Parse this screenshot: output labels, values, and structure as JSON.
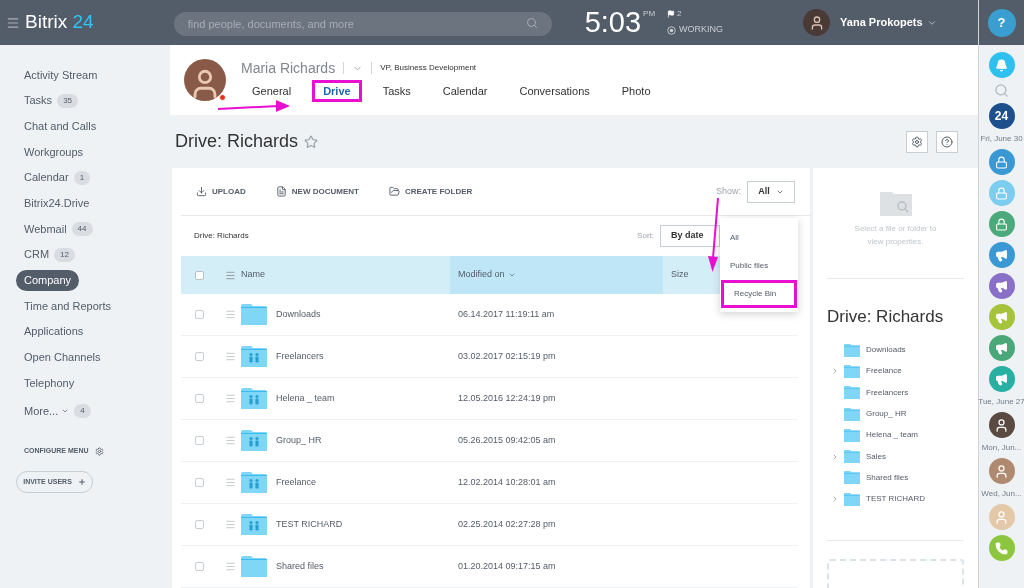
{
  "header": {
    "logo_word": "Bitrix",
    "logo_number": "24",
    "search": {
      "placeholder": "find people, documents, and more"
    },
    "time": "5:03",
    "ampm": "PM",
    "flags": "2",
    "status": "WORKING",
    "user": "Yana Prokopets"
  },
  "sidebar": {
    "items": [
      {
        "label": "Activity Stream",
        "selected": false
      },
      {
        "label": "Tasks",
        "badge": "35",
        "selected": false
      },
      {
        "label": "Chat and Calls",
        "selected": false
      },
      {
        "label": "Workgroups",
        "selected": false
      },
      {
        "label": "Calendar",
        "badge": "1",
        "selected": false
      },
      {
        "label": "Bitrix24.Drive",
        "selected": false
      },
      {
        "label": "Webmail",
        "badge": "44",
        "selected": false
      },
      {
        "label": "CRM",
        "badge": "12",
        "selected": false
      },
      {
        "label": "Company",
        "selected": true
      },
      {
        "label": "Time and Reports",
        "selected": false
      },
      {
        "label": "Applications",
        "selected": false
      },
      {
        "label": "Open Channels",
        "selected": false
      },
      {
        "label": "Telephony",
        "selected": false
      }
    ],
    "more": {
      "label": "More...",
      "badge": "4"
    },
    "configure": "CONFIGURE MENU",
    "invite": "INVITE USERS"
  },
  "profile": {
    "name": "Maria Richards",
    "position": "VP, Business Development",
    "online": false,
    "tabs": [
      {
        "label": "General",
        "selected": false,
        "highlighted": false
      },
      {
        "label": "Drive",
        "selected": true,
        "highlighted": true
      },
      {
        "label": "Tasks",
        "selected": false,
        "highlighted": false
      },
      {
        "label": "Calendar",
        "selected": false,
        "highlighted": false
      },
      {
        "label": "Conversations",
        "selected": false,
        "highlighted": false
      },
      {
        "label": "Photo",
        "selected": false,
        "highlighted": false
      }
    ]
  },
  "page_title": "Drive: Richards",
  "toolbar": {
    "actions": [
      {
        "kind": "upload",
        "label": "UPLOAD"
      },
      {
        "kind": "document",
        "label": "NEW DOCUMENT"
      },
      {
        "kind": "folder",
        "label": "CREATE FOLDER"
      }
    ],
    "show_label": "Show:",
    "show_value": "All",
    "menu": [
      {
        "label": "All",
        "highlighted": false
      },
      {
        "label": "Public files",
        "highlighted": false
      },
      {
        "label": "Recycle Bin",
        "highlighted": true
      }
    ]
  },
  "breadcrumb": "Drive: Richards",
  "sort_label": "Sort:",
  "sort_value": "By date",
  "table": {
    "all_checked": false,
    "columns": [
      {
        "label": "Name",
        "sorted": false
      },
      {
        "label": "Modified on",
        "sorted": true
      },
      {
        "label": "Size",
        "sorted": false
      }
    ],
    "rows": [
      {
        "name": "Downloads",
        "modified": "06.14.2017 11:19:11 am",
        "shared": false,
        "checked": false
      },
      {
        "name": "Freelancers",
        "modified": "03.02.2017 02:15:19 pm",
        "shared": true,
        "checked": false
      },
      {
        "name": "Helena _ team",
        "modified": "12.05.2016 12:24:19 pm",
        "shared": true,
        "checked": false
      },
      {
        "name": "Group_ HR",
        "modified": "05.26.2015 09:42:05 am",
        "shared": true,
        "checked": false
      },
      {
        "name": "Freelance",
        "modified": "12.02.2014 10:28:01 am",
        "shared": true,
        "checked": false
      },
      {
        "name": "TEST RICHARD",
        "modified": "02.25.2014 02:27:28 pm",
        "shared": true,
        "checked": false
      },
      {
        "name": "Shared files",
        "modified": "01.20.2014 09:17:15 am",
        "shared": false,
        "checked": false
      }
    ]
  },
  "properties": {
    "hint": "Select a file or folder to view properties.",
    "tree_title": "Drive: Richards",
    "tree": [
      {
        "label": "Downloads",
        "has_children": false
      },
      {
        "label": "Freelance",
        "has_children": true
      },
      {
        "label": "Freelancers",
        "has_children": false
      },
      {
        "label": "Group_ HR",
        "has_children": false
      },
      {
        "label": "Helena _ team",
        "has_children": false
      },
      {
        "label": "Sales",
        "has_children": true
      },
      {
        "label": "Shared files",
        "has_children": false
      },
      {
        "label": "TEST RICHARD",
        "has_children": true
      }
    ]
  },
  "rail": [
    {
      "kind": "help",
      "text": "?",
      "color": "#3a9fd0"
    },
    {
      "kind": "bell",
      "color": "#2fc0ef"
    },
    {
      "kind": "search"
    },
    {
      "kind": "logo",
      "text": "24",
      "color": "#1d4f8c"
    },
    {
      "kind": "date",
      "text": "Fri, June 30"
    },
    {
      "kind": "lock",
      "color": "#3a98d5"
    },
    {
      "kind": "lock",
      "color": "#7ccdf0"
    },
    {
      "kind": "lock",
      "color": "#4baa7a"
    },
    {
      "kind": "megaphone",
      "color": "#3a98d5"
    },
    {
      "kind": "megaphone",
      "color": "#8a6fc8"
    },
    {
      "kind": "megaphone",
      "color": "#a6c43b"
    },
    {
      "kind": "megaphone",
      "color": "#4aa878"
    },
    {
      "kind": "megaphone",
      "color": "#28b0a2"
    },
    {
      "kind": "date",
      "text": "Tue, June 27"
    },
    {
      "kind": "avatar",
      "color": "#5a4a42"
    },
    {
      "kind": "date",
      "text": "Mon, Jun..."
    },
    {
      "kind": "avatar",
      "color": "#b08a70"
    },
    {
      "kind": "date",
      "text": "Wed, Jun..."
    },
    {
      "kind": "avatar",
      "color": "#e4c9a8"
    },
    {
      "kind": "phone",
      "color": "#8cc63f"
    }
  ]
}
